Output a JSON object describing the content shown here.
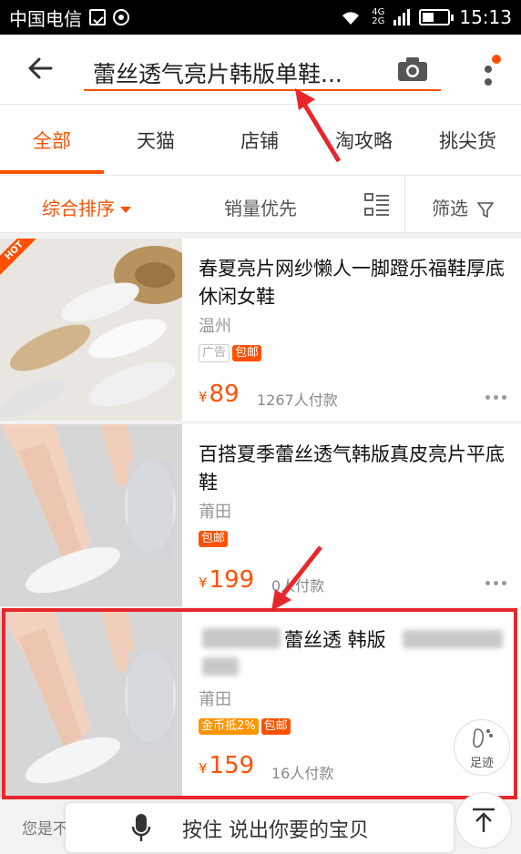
{
  "status_bar": {
    "carrier": "中国电信",
    "network_top": "4G",
    "network_bottom": "2G",
    "time": "15:13"
  },
  "search": {
    "query": "蕾丝透气亮片韩版单鞋...",
    "accent_color": "#ff5000"
  },
  "tabs": [
    {
      "label": "全部",
      "active": true
    },
    {
      "label": "天猫",
      "active": false
    },
    {
      "label": "店铺",
      "active": false
    },
    {
      "label": "淘攻略",
      "active": false
    },
    {
      "label": "挑尖货",
      "active": false
    }
  ],
  "sort": {
    "default_label": "综合排序",
    "sales_label": "销量优先",
    "filter_label": "筛选"
  },
  "products": [
    {
      "hot_badge": "HOT",
      "title": "春夏亮片网纱懒人一脚蹬乐福鞋厚底休闲女鞋",
      "location": "温州",
      "tags": [
        "广告",
        "包邮"
      ],
      "currency": "¥",
      "price": "89",
      "sold": "1267人付款"
    },
    {
      "title": "百搭夏季蕾丝透气韩版真皮亮片平底鞋",
      "location": "莆田",
      "tags": [
        "包邮"
      ],
      "currency": "¥",
      "price": "199",
      "sold": "0人付款"
    },
    {
      "title": "蕾丝透 韩版",
      "location": "莆田",
      "tags": [
        "金币抵2%",
        "包邮"
      ],
      "currency": "¥",
      "price": "159",
      "sold": "16人付款"
    }
  ],
  "footprint_label": "足迹",
  "voice": {
    "hint": "您是不",
    "button_label": "按住 说出你要的宝贝"
  },
  "colors": {
    "highlight": "#e8272c",
    "brand": "#ff5000"
  }
}
